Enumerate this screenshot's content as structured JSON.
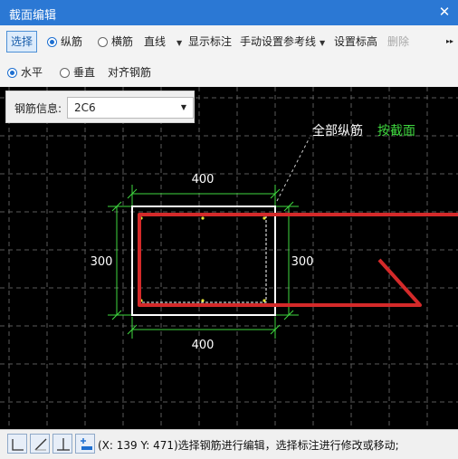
{
  "window": {
    "title": "截面编辑",
    "close_glyph": "✕"
  },
  "toolbar1": {
    "select_label": "选择",
    "longitudinal_label": "纵筋",
    "transverse_label": "横筋",
    "shape_value": "直线",
    "show_dimension_label": "显示标注",
    "manual_ref_line_label": "手动设置参考线",
    "set_elevation_label": "设置标高",
    "delete_label": "删除",
    "more_glyph": "▸▸"
  },
  "toolbar2": {
    "horizontal_label": "水平",
    "vertical_label": "垂直",
    "align_rebar_label": "对齐钢筋"
  },
  "rebar_info": {
    "label": "钢筋信息:",
    "value": "2C6"
  },
  "drawing": {
    "top_dim": "400",
    "bottom_dim": "400",
    "left_dim": "300",
    "right_dim": "300",
    "annotation_main": "全部纵筋",
    "annotation_mode": "按截面",
    "colors": {
      "background": "#000000",
      "grid": "#5a5a5a",
      "dimension": "#3fd83f",
      "section": "#ffffff",
      "rebar": "#d42a2a",
      "annotation_mode": "#3fd83f"
    }
  },
  "statusbar": {
    "icons": [
      "corner-icon",
      "diagonal-line-icon",
      "perpendicular-icon",
      "align-icon"
    ],
    "message": "(X: 139 Y: 471)选择钢筋进行编辑，选择标注进行修改或移动;"
  }
}
